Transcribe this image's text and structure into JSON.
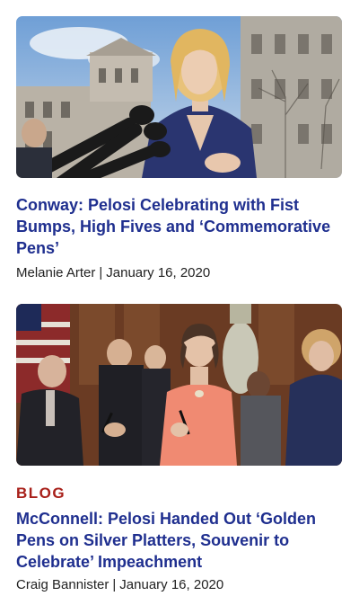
{
  "articles": [
    {
      "category": "",
      "headline": "Conway: Pelosi Celebrating with Fist Bumps, High Fives and ‘Commemorative Pens’",
      "author": "Melanie Arter",
      "separator": "|",
      "date": "January 16, 2020",
      "image_subject": "woman-speaking-at-microphones-photo"
    },
    {
      "category": "BLOG",
      "headline": "McConnell: Pelosi Handed Out ‘Golden Pens on Silver Platters, Souvenir to Celebrate’ Impeachment",
      "author": "Craig Bannister",
      "separator": "|",
      "date": "January 16, 2020",
      "image_subject": "group-with-pens-photo"
    }
  ],
  "colors": {
    "headline": "#1f2f8f",
    "category": "#a8201a",
    "byline": "#222222"
  }
}
